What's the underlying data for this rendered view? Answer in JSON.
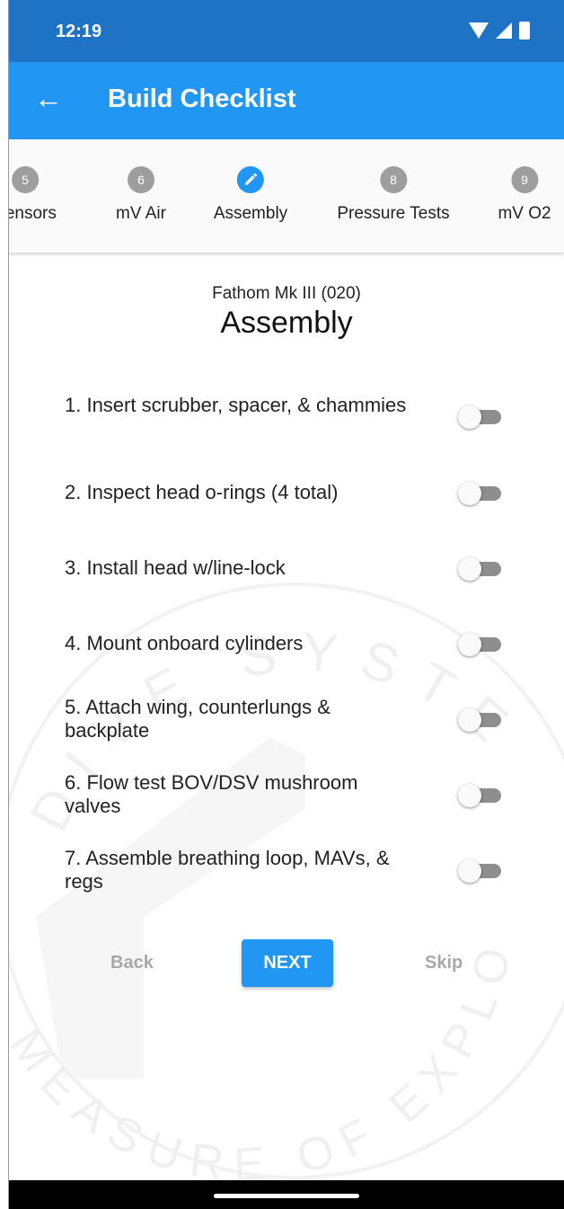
{
  "status": {
    "time": "12:19"
  },
  "app_bar": {
    "title": "Build Checklist"
  },
  "steps": [
    {
      "number": "5",
      "label": "Sensors"
    },
    {
      "number": "6",
      "label": "mV Air"
    },
    {
      "number": "",
      "label": "Assembly",
      "active": true
    },
    {
      "number": "8",
      "label": "Pressure Tests"
    },
    {
      "number": "9",
      "label": "mV O2"
    }
  ],
  "main": {
    "subtitle": "Fathom Mk III (020)",
    "title": "Assembly",
    "items": [
      {
        "text": "1. Insert scrubber, spacer, & chammies",
        "checked": false
      },
      {
        "text": "2. Inspect head o-rings (4 total)",
        "checked": false
      },
      {
        "text": "3. Install head w/line-lock",
        "checked": false
      },
      {
        "text": "4. Mount onboard cylinders",
        "checked": false
      },
      {
        "text": "5. Attach wing, counterlungs & backplate",
        "checked": false
      },
      {
        "text": "6. Flow test BOV/DSV mushroom valves",
        "checked": false
      },
      {
        "text": "7. Assemble breathing loop, MAVs, & regs",
        "checked": false
      }
    ]
  },
  "buttons": {
    "back": "Back",
    "next": "NEXT",
    "skip": "Skip"
  },
  "watermark": {
    "top": "DIVE SYSTEMS",
    "bottom": "MEASURE OF EXPLORATION"
  },
  "colors": {
    "primary": "#2196f3",
    "status_bar": "#1e73c4",
    "inactive_step": "#9e9e9e"
  }
}
